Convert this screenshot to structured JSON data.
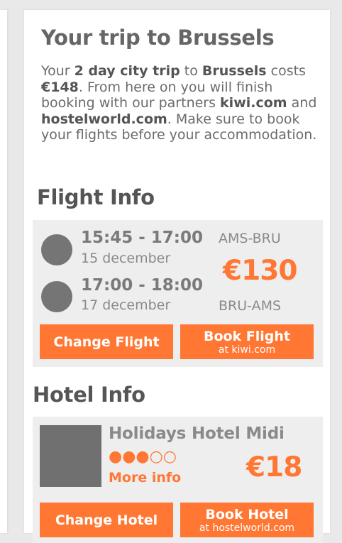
{
  "trip": {
    "title": "Your trip to Brussels",
    "desc": {
      "p1": "Your ",
      "duration": "2 day city trip",
      "p2": " to ",
      "city": "Brussels",
      "p3": " costs ",
      "cost": "€148",
      "p4": ". From here on you will finish booking with our partners ",
      "partner1": "kiwi.com",
      "p5": " and ",
      "partner2": "hostelworld.com",
      "p6": ". Make sure to book your flights before your accommodation."
    }
  },
  "flight": {
    "section_title": "Flight Info",
    "legs": [
      {
        "time": "15:45 - 17:00",
        "date": "15 december",
        "route": "AMS-BRU"
      },
      {
        "time": "17:00 - 18:00",
        "date": "17 december",
        "route": "BRU-AMS"
      }
    ],
    "price": "€130",
    "change_label": "Change Flight",
    "book_label": "Book Flight",
    "book_sub": "at kiwi.com"
  },
  "hotel": {
    "section_title": "Hotel Info",
    "name": "Holidays Hotel Midi",
    "rating": 3,
    "rating_max": 5,
    "stars_display": "●●●○○",
    "more_info": "More info",
    "price": "€18",
    "change_label": "Change Hotel",
    "book_label": "Book Hotel",
    "book_sub": "at hostelworld.com"
  },
  "colors": {
    "accent": "#ff7733",
    "text": "#666666",
    "panel": "#eeeeee"
  }
}
